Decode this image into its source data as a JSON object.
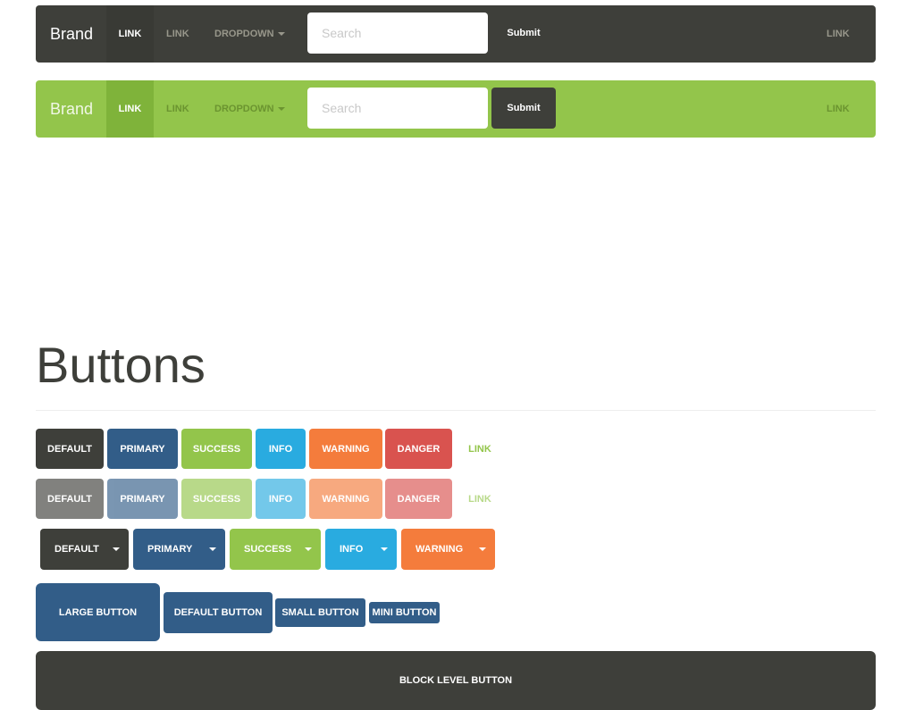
{
  "navbar_default": {
    "brand": "Brand",
    "links": [
      "Link",
      "Link"
    ],
    "dropdown": "Dropdown",
    "search_placeholder": "Search",
    "submit": "Submit",
    "right_link": "Link"
  },
  "navbar_success": {
    "brand": "Brand",
    "links": [
      "Link",
      "Link"
    ],
    "dropdown": "Dropdown",
    "search_placeholder": "Search",
    "submit": "Submit",
    "right_link": "Link"
  },
  "section_title": "Buttons",
  "buttons": {
    "row1": [
      "Default",
      "Primary",
      "Success",
      "Info",
      "Warning",
      "Danger",
      "Link"
    ],
    "row2_disabled": [
      "Default",
      "Primary",
      "Success",
      "Info",
      "Warning",
      "Danger",
      "Link"
    ],
    "split": [
      "Default",
      "Primary",
      "Success",
      "Info",
      "Warning"
    ],
    "sizes": [
      "Large button",
      "Default button",
      "Small button",
      "Mini button"
    ],
    "block": "Block level button"
  },
  "colors": {
    "default": "#3e3f3a",
    "primary": "#325d88",
    "success": "#93c54b",
    "info": "#29abe0",
    "warning": "#f47c3c",
    "danger": "#d9534f"
  }
}
